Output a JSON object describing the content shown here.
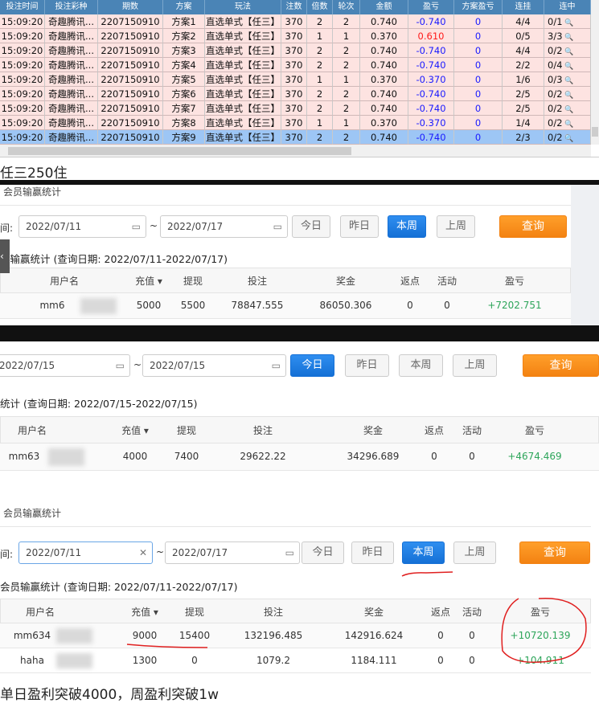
{
  "grid": {
    "columns": [
      "投注时间",
      "投注彩种",
      "期数",
      "方案",
      "玩法",
      "注数",
      "倍数",
      "轮次",
      "金额",
      "盈亏",
      "方案盈亏",
      "连挂",
      "连中"
    ],
    "rows": [
      [
        "15:09:20",
        "奇趣腾讯...",
        "2207150910",
        "方案1",
        "直选单式【任三】",
        "370",
        "2",
        "2",
        "0.740",
        "-0.740",
        "0",
        "4/4",
        "0/1"
      ],
      [
        "15:09:20",
        "奇趣腾讯...",
        "2207150910",
        "方案2",
        "直选单式【任三】",
        "370",
        "1",
        "1",
        "0.370",
        "0.610",
        "0",
        "0/5",
        "3/3"
      ],
      [
        "15:09:20",
        "奇趣腾讯...",
        "2207150910",
        "方案3",
        "直选单式【任三】",
        "370",
        "2",
        "2",
        "0.740",
        "-0.740",
        "0",
        "4/4",
        "0/2"
      ],
      [
        "15:09:20",
        "奇趣腾讯...",
        "2207150910",
        "方案4",
        "直选单式【任三】",
        "370",
        "2",
        "2",
        "0.740",
        "-0.740",
        "0",
        "2/2",
        "0/4"
      ],
      [
        "15:09:20",
        "奇趣腾讯...",
        "2207150910",
        "方案5",
        "直选单式【任三】",
        "370",
        "1",
        "1",
        "0.370",
        "-0.370",
        "0",
        "1/6",
        "0/3"
      ],
      [
        "15:09:20",
        "奇趣腾讯...",
        "2207150910",
        "方案6",
        "直选单式【任三】",
        "370",
        "2",
        "2",
        "0.740",
        "-0.740",
        "0",
        "2/5",
        "0/2"
      ],
      [
        "15:09:20",
        "奇趣腾讯...",
        "2207150910",
        "方案7",
        "直选单式【任三】",
        "370",
        "2",
        "2",
        "0.740",
        "-0.740",
        "0",
        "2/5",
        "0/2"
      ],
      [
        "15:09:20",
        "奇趣腾讯...",
        "2207150910",
        "方案8",
        "直选单式【任三】",
        "370",
        "1",
        "1",
        "0.370",
        "-0.370",
        "0",
        "1/4",
        "0/2"
      ],
      [
        "15:09:20",
        "奇趣腾讯...",
        "2207150910",
        "方案9",
        "直选单式【任三】",
        "370",
        "2",
        "2",
        "0.740",
        "-0.740",
        "0",
        "2/3",
        "0/2"
      ]
    ],
    "selected_row": 8
  },
  "caption1": "任三250住",
  "caption2": "单日盈利突破4000，周盈利突破1w",
  "colors": {
    "primary": "#1570d6",
    "query": "#f38212",
    "profit": "#2da55a",
    "loss": "#1a1aff",
    "win": "#ff1a1a",
    "annotation": "#e02020"
  },
  "stats_columns": [
    "用户名",
    "充值",
    "提现",
    "投注",
    "奖金",
    "返点",
    "活动",
    "盈亏"
  ],
  "buttons": [
    "今日",
    "昨日",
    "本周",
    "上周"
  ],
  "query_label": "查询",
  "panel1": {
    "title": "会员输赢统计",
    "label": "间:",
    "start": "2022/07/11",
    "end": "2022/07/17",
    "active": "本周",
    "subtitle": "员输赢统计 (查询日期: 2022/07/11-2022/07/17)",
    "rows": [
      [
        "mm6",
        "5000",
        "5500",
        "78847.555",
        "86050.306",
        "0",
        "0",
        "+7202.751"
      ]
    ]
  },
  "panel2": {
    "start": "2022/07/15",
    "end": "2022/07/15",
    "active": "今日",
    "subtitle": "统计 (查询日期: 2022/07/15-2022/07/15)",
    "rows": [
      [
        "mm63",
        "4000",
        "7400",
        "29622.22",
        "34296.689",
        "0",
        "0",
        "+4674.469"
      ]
    ]
  },
  "panel3": {
    "title": "会员输赢统计",
    "label": "间:",
    "start": "2022/07/11",
    "end": "2022/07/17",
    "active": "本周",
    "subtitle": "会员输赢统计 (查询日期: 2022/07/11-2022/07/17)",
    "rows": [
      [
        "mm634",
        "9000",
        "15400",
        "132196.485",
        "142916.624",
        "0",
        "0",
        "+10720.139"
      ],
      [
        "haha",
        "1300",
        "0",
        "1079.2",
        "1184.111",
        "0",
        "0",
        "+104.911"
      ]
    ]
  }
}
